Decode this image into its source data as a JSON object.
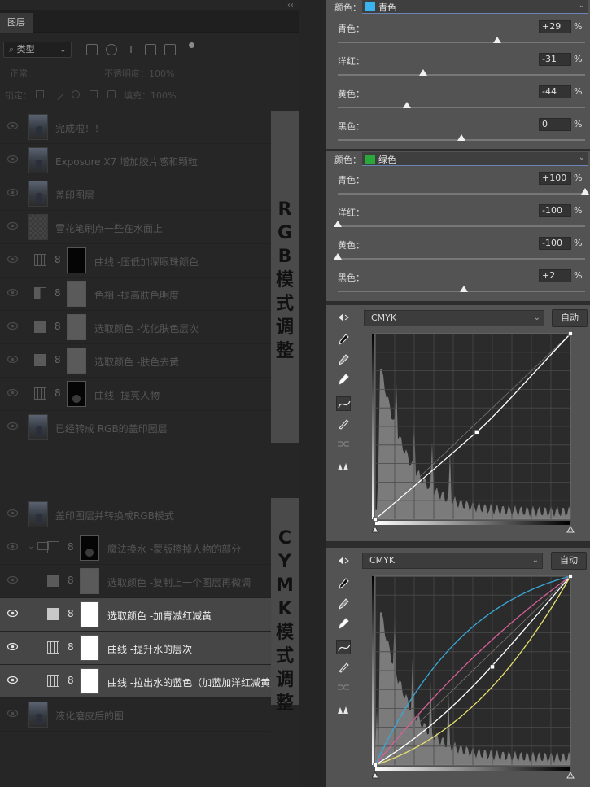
{
  "layers_panel": {
    "tab_label": "图层",
    "collapse_glyph": "‹‹",
    "filter_kind": "类型",
    "blend_mode": "正常",
    "opacity_label": "不透明度：100%",
    "lock_label": "锁定：",
    "fill_label": "填充：100%",
    "layers": [
      {
        "name": "完成啦！！",
        "kind": "pixel",
        "visible": false
      },
      {
        "name": "Exposure X7 增加胶片感和颗粒",
        "kind": "pixel",
        "visible": false
      },
      {
        "name": "盖印图层",
        "kind": "pixel",
        "visible": false
      },
      {
        "name": "雪花笔刷点一些在水面上",
        "kind": "transparent",
        "visible": false
      },
      {
        "name": "曲线 -压低加深眼珠颜色",
        "kind": "curves",
        "mask": "black",
        "visible": false
      },
      {
        "name": "色相 -提高肤色明度",
        "kind": "hue",
        "mask": "gray",
        "visible": false
      },
      {
        "name": "选取颜色 -优化肤色层次",
        "kind": "selective",
        "mask": "gray",
        "visible": false
      },
      {
        "name": "选取颜色 -肤色去黄",
        "kind": "selective",
        "mask": "gray",
        "visible": false
      },
      {
        "name": "曲线 -提亮人物",
        "kind": "curves",
        "mask": "figure",
        "visible": false
      },
      {
        "name": "已经转成 RGB的盖印图层",
        "kind": "pixel",
        "visible": false
      },
      {
        "name": "盖印图层并转换成RGB模式",
        "kind": "pixel",
        "visible": false
      },
      {
        "name": "魔法换水 -蒙版擦掉人物的部分",
        "kind": "group",
        "mask": "figure",
        "visible": false
      },
      {
        "name": "选取颜色 -复制上一个图层再微调",
        "kind": "selective",
        "mask": "gray",
        "visible": false
      },
      {
        "name": "选取颜色 -加青减红减黄",
        "kind": "selective",
        "mask": "white",
        "visible": true,
        "active": true
      },
      {
        "name": "曲线 -提升水的层次",
        "kind": "curves",
        "mask": "white",
        "visible": true,
        "active": true
      },
      {
        "name": "曲线 -拉出水的蓝色（加蓝加洋红减黄）",
        "kind": "curves",
        "mask": "white",
        "visible": true,
        "active": true
      },
      {
        "name": "液化磨皮后的图",
        "kind": "pixel",
        "visible": false
      }
    ],
    "rgb_annotation": [
      "R",
      "G",
      "B",
      "模",
      "式",
      "调",
      "整"
    ],
    "cymk_annotation": [
      "C",
      "Y",
      "M",
      "K",
      "模",
      "式",
      "调",
      "整"
    ]
  },
  "properties": {
    "selective_color_1": {
      "color_label": "颜色：",
      "color_name": "青色",
      "swatch": "#3ab4ee",
      "sliders": [
        {
          "label": "青色：",
          "value": "+29",
          "percent": 29
        },
        {
          "label": "洋红：",
          "value": "-31",
          "percent": -31
        },
        {
          "label": "黄色：",
          "value": "-44",
          "percent": -44
        },
        {
          "label": "黑色：",
          "value": "0",
          "percent": 0
        }
      ],
      "unit": "%"
    },
    "selective_color_2": {
      "color_label": "颜色：",
      "color_name": "绿色",
      "swatch": "#2aa83a",
      "sliders": [
        {
          "label": "青色：",
          "value": "+100",
          "percent": 100
        },
        {
          "label": "洋红：",
          "value": "-100",
          "percent": -100
        },
        {
          "label": "黄色：",
          "value": "-100",
          "percent": -100
        },
        {
          "label": "黑色：",
          "value": "+2",
          "percent": 2
        }
      ],
      "unit": "%"
    },
    "curves_1": {
      "preset": "CMYK",
      "auto_label": "自动",
      "curve_points": [
        [
          0,
          0
        ],
        [
          0.52,
          0.47
        ],
        [
          1,
          1
        ]
      ],
      "curve_color": "#ffffff"
    },
    "curves_2": {
      "preset": "CMYK",
      "auto_label": "自动",
      "curves": [
        {
          "channel": "cyan",
          "color": "#3aa7d8"
        },
        {
          "channel": "magenta",
          "color": "#d8609a"
        },
        {
          "channel": "yellow",
          "color": "#e8e070"
        },
        {
          "channel": "composite",
          "color": "#ffffff"
        }
      ]
    },
    "tools": [
      "curves-target-icon",
      "black-eyedropper-icon",
      "gray-eyedropper-icon",
      "white-eyedropper-icon",
      "curve-point-icon",
      "pencil-icon",
      "smooth-icon",
      "clipping-warning-icon"
    ]
  }
}
